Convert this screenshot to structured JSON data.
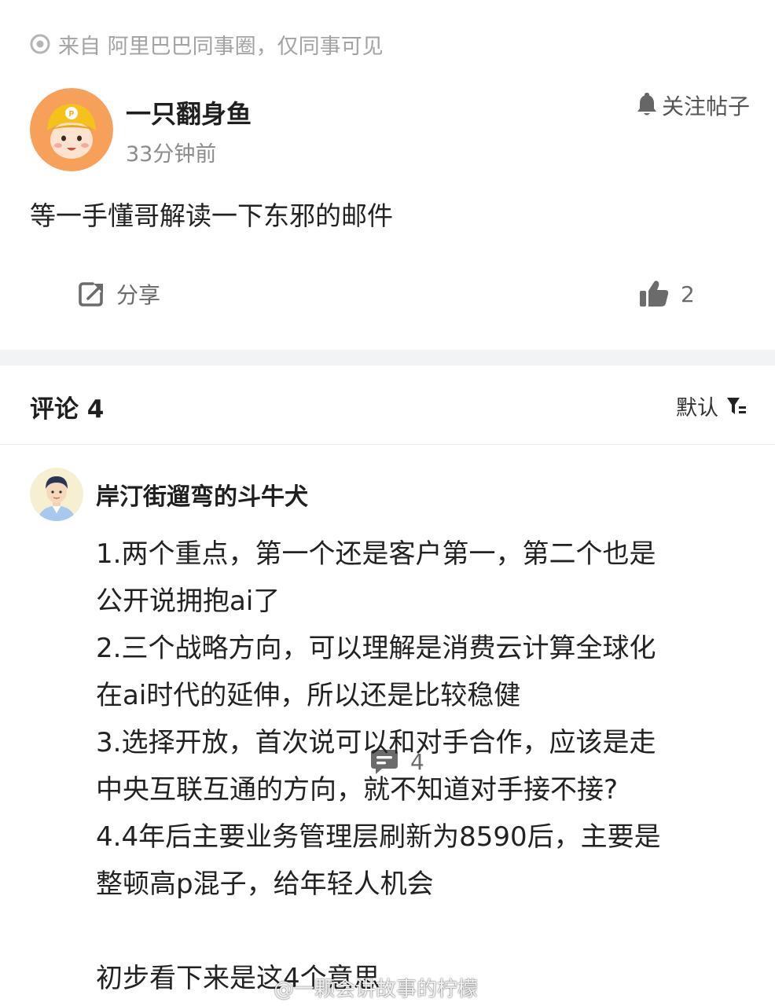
{
  "source": {
    "text": "来自 阿里巴巴同事圈，仅同事可见",
    "icon": "target-icon"
  },
  "post": {
    "author": "一只翻身鱼",
    "time": "33分钟前",
    "follow_label": "关注帖子",
    "content": "等一手懂哥解读一下东邪的邮件",
    "actions": {
      "share_label": "分享",
      "comment_count": "4",
      "like_count": "2"
    }
  },
  "comments": {
    "title": "评论 4",
    "sort_label": "默认",
    "items": [
      {
        "author": "岸汀街遛弯的斗牛犬",
        "lines": [
          "1.两个重点，第一个还是客户第一，第二个也是",
          "公开说拥抱ai了",
          "2.三个战略方向，可以理解是消费云计算全球化",
          "在ai时代的延伸，所以还是比较稳健",
          "3.选择开放，首次说可以和对手合作，应该是走",
          "中央互联互通的方向，就不知道对手接不接?",
          "4.4年后主要业务管理层刷新为8590后，主要是",
          "整顿高p混子，给年轻人机会",
          "",
          "初步看下来是这4个意思"
        ]
      }
    ]
  },
  "watermark": "@一颗会讲故事的柠檬",
  "colors": {
    "avatar_bg": "#f6a05a",
    "hat": "#f5c21b",
    "gray_text": "#8c8c8c",
    "section_gap": "#f2f3f5"
  }
}
